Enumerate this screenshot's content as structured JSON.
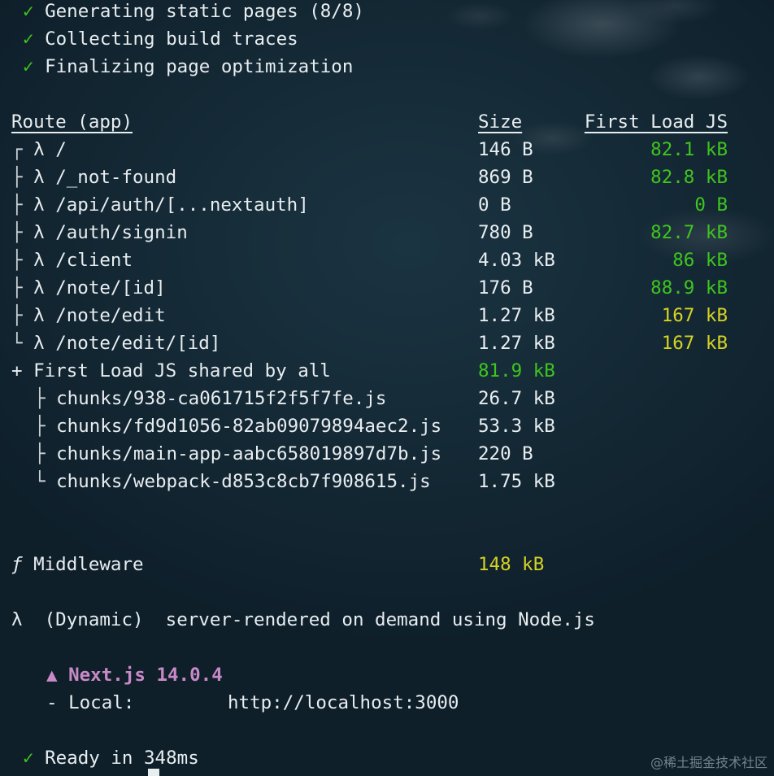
{
  "status_lines": [
    {
      "check": "✓",
      "text": "Generating static pages (8/8)"
    },
    {
      "check": "✓",
      "text": "Collecting build traces"
    },
    {
      "check": "✓",
      "text": "Finalizing page optimization"
    }
  ],
  "route_header": {
    "route": "Route (app)",
    "size": "Size",
    "first_load": "First Load JS"
  },
  "routes": [
    {
      "tree": "┌",
      "sym": "λ",
      "path": "/",
      "size": "146 B",
      "first_load": "82.1 kB",
      "color": "#3fc51e"
    },
    {
      "tree": "├",
      "sym": "λ",
      "path": "/_not-found",
      "size": "869 B",
      "first_load": "82.8 kB",
      "color": "#3fc51e"
    },
    {
      "tree": "├",
      "sym": "λ",
      "path": "/api/auth/[...nextauth]",
      "size": "0 B",
      "first_load": "0 B",
      "color": "#3fc51e"
    },
    {
      "tree": "├",
      "sym": "λ",
      "path": "/auth/signin",
      "size": "780 B",
      "first_load": "82.7 kB",
      "color": "#3fc51e"
    },
    {
      "tree": "├",
      "sym": "λ",
      "path": "/client",
      "size": "4.03 kB",
      "first_load": "86 kB",
      "color": "#3fc51e"
    },
    {
      "tree": "├",
      "sym": "λ",
      "path": "/note/[id]",
      "size": "176 B",
      "first_load": "88.9 kB",
      "color": "#3fc51e"
    },
    {
      "tree": "├",
      "sym": "λ",
      "path": "/note/edit",
      "size": "1.27 kB",
      "first_load": "167 kB",
      "color": "#d6d323"
    },
    {
      "tree": "└",
      "sym": "λ",
      "path": "/note/edit/[id]",
      "size": "1.27 kB",
      "first_load": "167 kB",
      "color": "#d6d323"
    }
  ],
  "shared": {
    "prefix": "+",
    "label": "First Load JS shared by all",
    "size": "81.9 kB"
  },
  "chunks": [
    {
      "tree": "├",
      "name": "chunks/938-ca061715f2f5f7fe.js",
      "size": "26.7 kB"
    },
    {
      "tree": "├",
      "name": "chunks/fd9d1056-82ab09079894aec2.js",
      "size": "53.3 kB"
    },
    {
      "tree": "├",
      "name": "chunks/main-app-aabc658019897d7b.js",
      "size": "220 B"
    },
    {
      "tree": "└",
      "name": "chunks/webpack-d853c8cb7f908615.js",
      "size": "1.75 kB"
    }
  ],
  "middleware": {
    "sym": "ƒ",
    "label": "Middleware",
    "size": "148 kB"
  },
  "legend": {
    "sym": "λ",
    "type": "(Dynamic)",
    "desc": "server-rendered on demand using Node.js"
  },
  "nextjs": {
    "icon": "▲",
    "name": "Next.js 14.0.4",
    "local_label": "- Local:",
    "local_url": "http://localhost:3000"
  },
  "ready": {
    "check": "✓",
    "text": "Ready in 348ms"
  },
  "watermark": "@稀土掘金技术社区"
}
